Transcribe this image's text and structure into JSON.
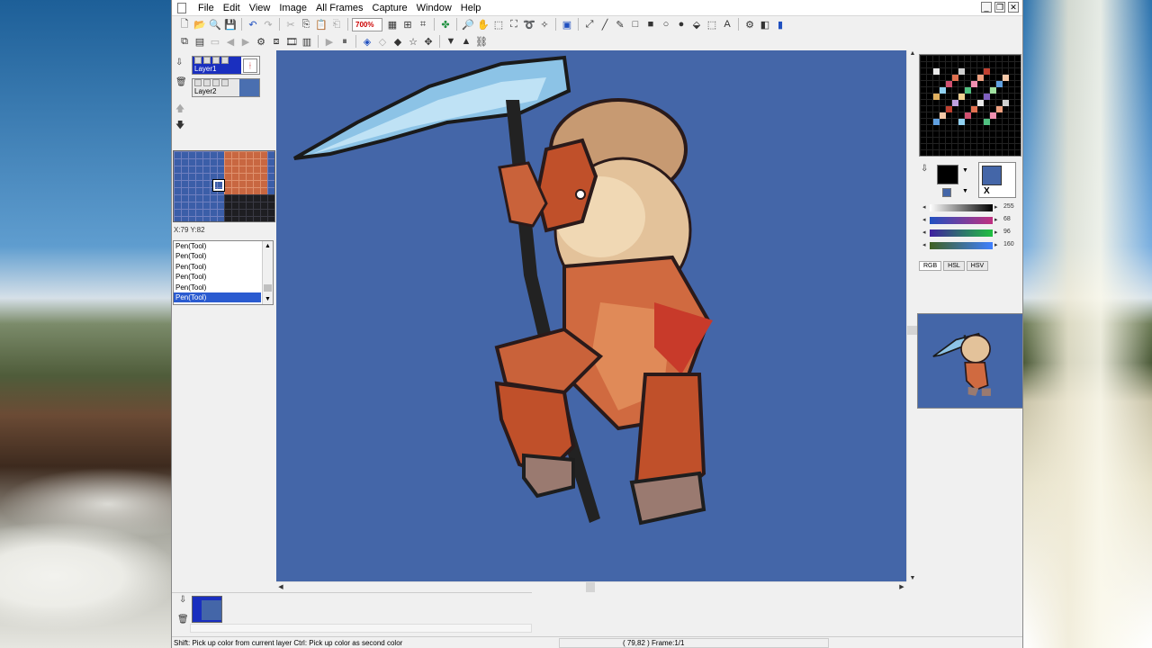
{
  "menus": [
    "File",
    "Edit",
    "View",
    "Image",
    "All Frames",
    "Capture",
    "Window",
    "Help"
  ],
  "toolbar": {
    "zoom_value": "700%"
  },
  "layers": [
    {
      "name": "Layer1",
      "selected": true
    },
    {
      "name": "Layer2",
      "selected": false
    }
  ],
  "navigator": {
    "coords": "X:79 Y:82"
  },
  "history": {
    "items": [
      "Pen(Tool)",
      "Pen(Tool)",
      "Pen(Tool)",
      "Pen(Tool)",
      "Pen(Tool)",
      "Pen(Tool)"
    ],
    "selected_index": 5
  },
  "color": {
    "primary": "#000000",
    "secondary_fg": "#4466a8",
    "secondary_bg": "#b25a3c",
    "gray_value": "255",
    "r_value": "68",
    "g_value": "96",
    "b_value": "160",
    "swap_label": "X",
    "modes": [
      "RGB",
      "HSL",
      "HSV"
    ],
    "active_mode": "RGB"
  },
  "canvas": {
    "background_color": "#4466a8"
  },
  "status": {
    "hint": "Shift: Pick up color from current layer  Ctrl: Pick up color as second color",
    "position": "( 79,82 )  Frame:1/1"
  }
}
